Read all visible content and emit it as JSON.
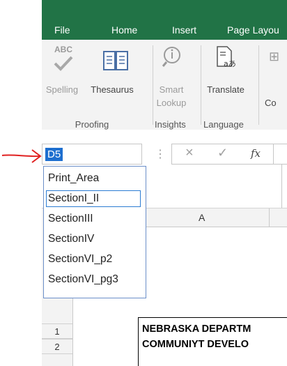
{
  "ribbon_tabs": [
    "File",
    "Home",
    "Insert",
    "Page Layou"
  ],
  "ribbon_buttons": {
    "spelling": "Spelling",
    "thesaurus": "Thesaurus",
    "smart_lookup_line1": "Smart",
    "smart_lookup_line2": "Lookup",
    "translate": "Translate",
    "partial_co": "Co"
  },
  "ribbon_groups": {
    "proofing": "Proofing",
    "insights": "Insights",
    "language": "Language"
  },
  "abc_icon_text": "ABC",
  "name_box": {
    "value": "D5"
  },
  "formula_bar": {
    "cancel_icon": "×",
    "enter_icon": "✓",
    "fx_icon": "fx"
  },
  "named_ranges": [
    "Print_Area",
    "SectionI_II",
    "SectionIII",
    "SectionIV",
    "SectionVI_p2",
    "SectionVI_pg3"
  ],
  "selected_range": "SectionI_II",
  "column_header": "A",
  "row_numbers": [
    "1",
    "2"
  ],
  "cells": {
    "row1": "NEBRASKA DEPARTM",
    "row2": "COMMUNIYT DEVELO"
  },
  "colors": {
    "ribbon_green": "#217346",
    "selection_blue": "#1e6fcf",
    "annotation_red": "#e02020"
  }
}
